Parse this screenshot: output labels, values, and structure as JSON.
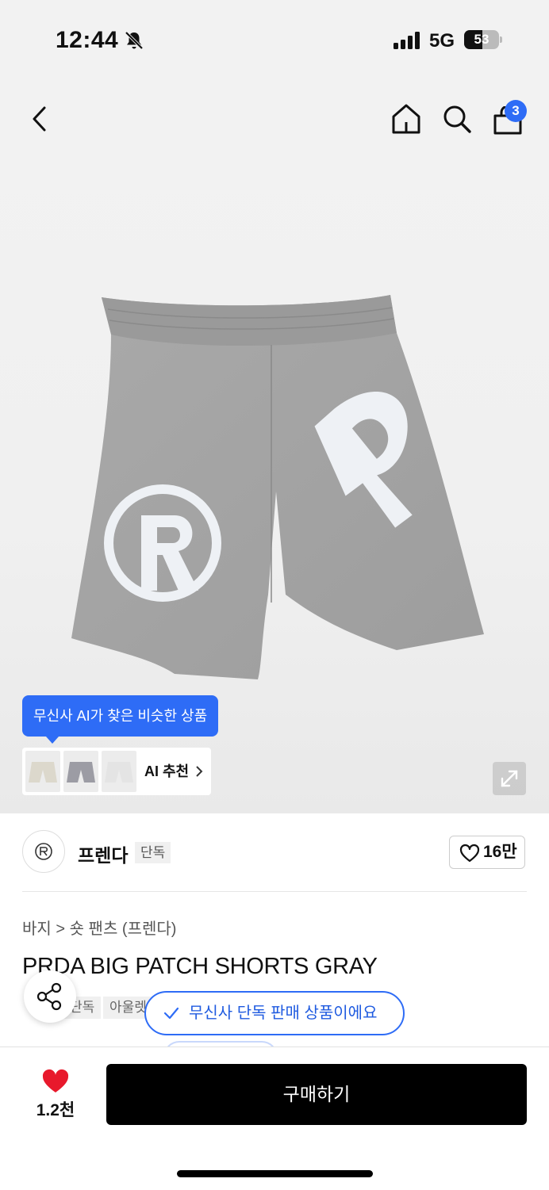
{
  "status_bar": {
    "time": "12:44",
    "network": "5G",
    "battery": "53",
    "battery_level": 0.53
  },
  "header": {
    "cart_count": "3"
  },
  "ai_recommend": {
    "tooltip": "무신사 AI가 찾은 비슷한 상품",
    "label": "AI 추천"
  },
  "brand": {
    "name": "프렌다",
    "tag": "단독",
    "likes": "16만"
  },
  "product": {
    "breadcrumb": "바지 > 숏 팬츠 (프렌다)",
    "title": "PRDA BIG PATCH SHORTS GRAY",
    "chips": [
      "단독",
      "아울렛"
    ]
  },
  "toast": {
    "message": "무신사 단독 판매 상품이에요"
  },
  "bottom_bar": {
    "like_count": "1.2천",
    "buy_label": "구매하기"
  },
  "colors": {
    "accent": "#2e6cf6",
    "heart": "#e8192c",
    "buy_button": "#000000"
  }
}
